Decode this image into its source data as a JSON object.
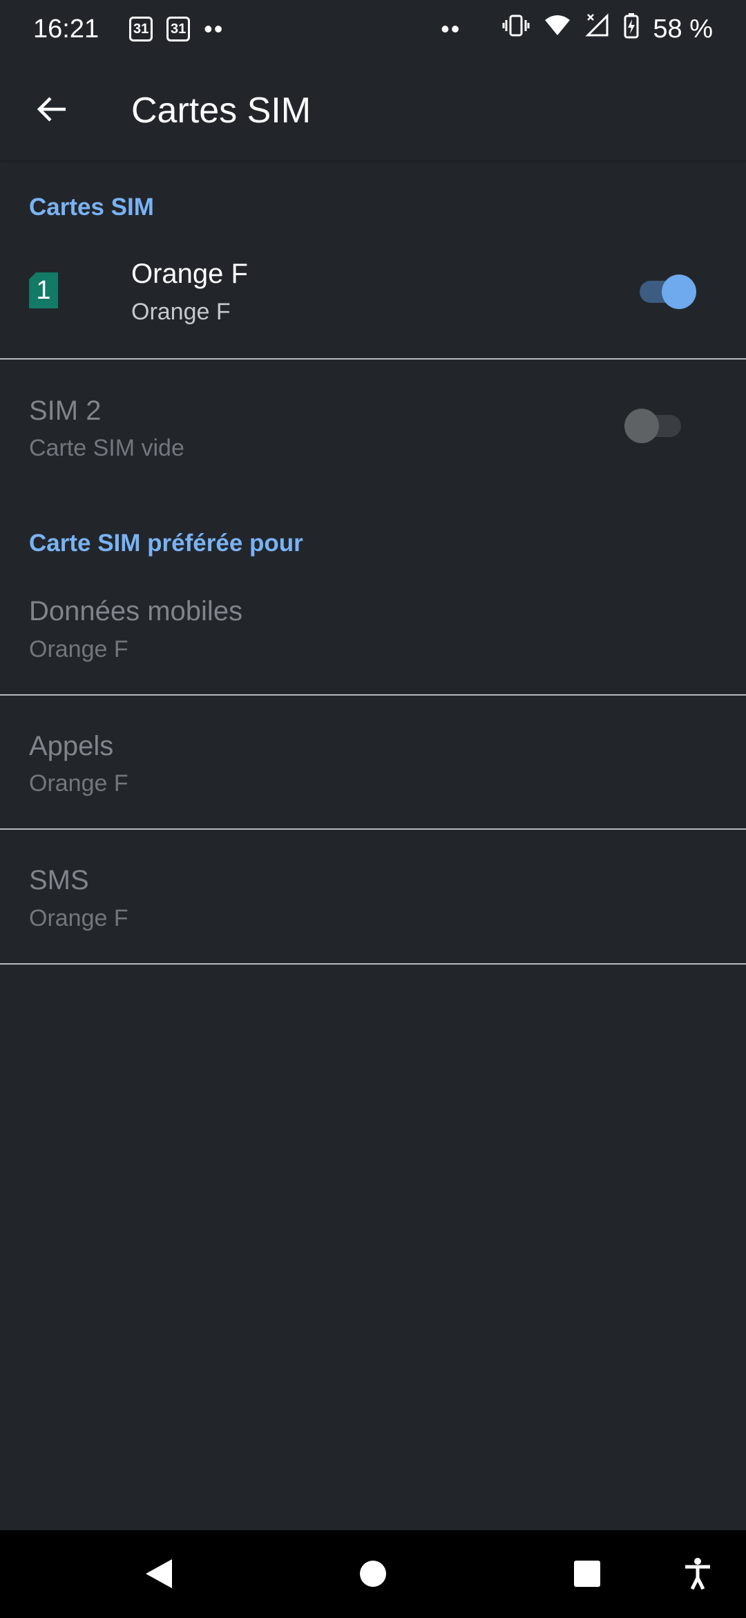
{
  "status": {
    "time": "16:21",
    "cal1": "31",
    "cal2": "31",
    "dots_left": "••",
    "dots_right": "••",
    "battery": "58 %"
  },
  "appbar": {
    "title": "Cartes SIM"
  },
  "sections": {
    "sims_header": "Cartes SIM",
    "preferred_header": "Carte SIM préférée pour"
  },
  "sim1": {
    "badge": "1",
    "title": "Orange F",
    "subtitle": "Orange F",
    "enabled": true
  },
  "sim2": {
    "title": "SIM 2",
    "subtitle": "Carte SIM vide",
    "enabled": false
  },
  "preferred": [
    {
      "title": "Données mobiles",
      "subtitle": "Orange F"
    },
    {
      "title": "Appels",
      "subtitle": "Orange F"
    },
    {
      "title": "SMS",
      "subtitle": "Orange F"
    }
  ],
  "colors": {
    "accent": "#7ab3f4",
    "background": "#22262b",
    "sim_badge": "#127a67"
  }
}
